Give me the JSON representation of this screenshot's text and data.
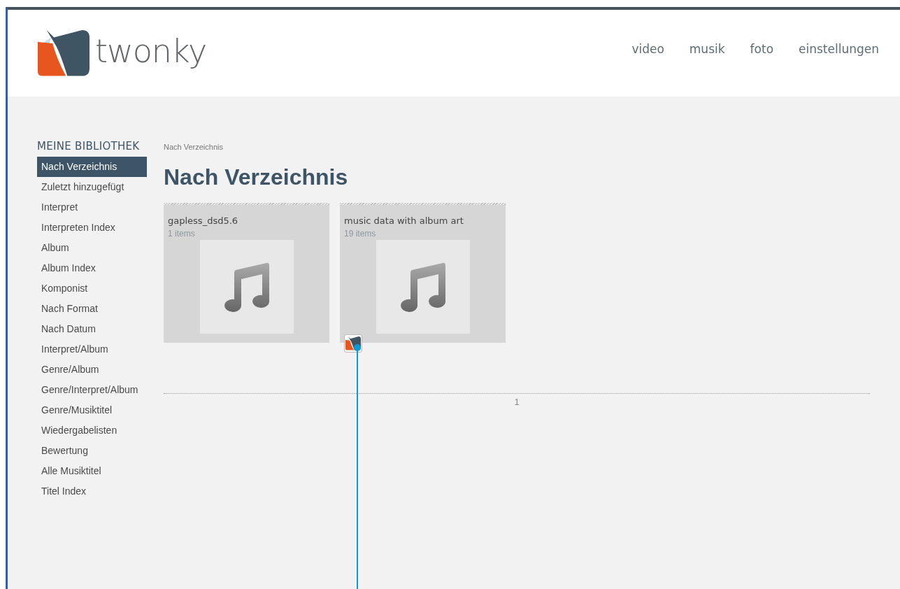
{
  "header": {
    "logo_text": "twonky",
    "nav": [
      "video",
      "musik",
      "foto",
      "einstellungen"
    ]
  },
  "sidebar": {
    "heading": "MEINE BIBLIOTHEK",
    "items": [
      {
        "label": "Nach Verzeichnis",
        "selected": true
      },
      {
        "label": "Zuletzt hinzugefügt",
        "selected": false
      },
      {
        "label": "Interpret",
        "selected": false
      },
      {
        "label": "Interpreten Index",
        "selected": false
      },
      {
        "label": "Album",
        "selected": false
      },
      {
        "label": "Album Index",
        "selected": false
      },
      {
        "label": "Komponist",
        "selected": false
      },
      {
        "label": "Nach Format",
        "selected": false
      },
      {
        "label": "Nach Datum",
        "selected": false
      },
      {
        "label": "Interpret/Album",
        "selected": false
      },
      {
        "label": "Genre/Album",
        "selected": false
      },
      {
        "label": "Genre/Interpret/Album",
        "selected": false
      },
      {
        "label": "Genre/Musiktitel",
        "selected": false
      },
      {
        "label": "Wiedergabelisten",
        "selected": false
      },
      {
        "label": "Bewertung",
        "selected": false
      },
      {
        "label": "Alle Musiktitel",
        "selected": false
      },
      {
        "label": "Titel Index",
        "selected": false
      }
    ]
  },
  "content": {
    "breadcrumb": "Nach Verzeichnis",
    "title": "Nach Verzeichnis",
    "folders": [
      {
        "name": "gapless_dsd5.6",
        "count": "1 items"
      },
      {
        "name": "music data with album art",
        "count": "19 items"
      }
    ],
    "pagination": [
      "1"
    ]
  }
}
